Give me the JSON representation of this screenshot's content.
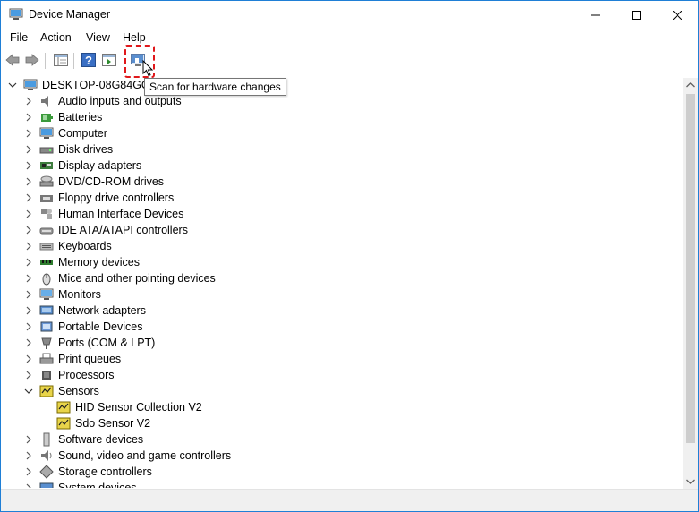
{
  "window": {
    "title": "Device Manager"
  },
  "menu": [
    "File",
    "Action",
    "View",
    "Help"
  ],
  "tooltip": "Scan for hardware changes",
  "colors": {
    "accent": "#1f7fd6",
    "highlight": "#e0181b"
  },
  "tree": {
    "root": "DESKTOP-08G84GC",
    "items": [
      {
        "label": "Audio inputs and outputs",
        "icon": "speaker-icon"
      },
      {
        "label": "Batteries",
        "icon": "battery-icon"
      },
      {
        "label": "Computer",
        "icon": "computer-icon"
      },
      {
        "label": "Disk drives",
        "icon": "disk-drive-icon"
      },
      {
        "label": "Display adapters",
        "icon": "display-adapter-icon"
      },
      {
        "label": "DVD/CD-ROM drives",
        "icon": "dvd-drive-icon"
      },
      {
        "label": "Floppy drive controllers",
        "icon": "floppy-controller-icon"
      },
      {
        "label": "Human Interface Devices",
        "icon": "hid-icon"
      },
      {
        "label": "IDE ATA/ATAPI controllers",
        "icon": "ide-controller-icon"
      },
      {
        "label": "Keyboards",
        "icon": "keyboard-icon"
      },
      {
        "label": "Memory devices",
        "icon": "memory-icon"
      },
      {
        "label": "Mice and other pointing devices",
        "icon": "mouse-icon"
      },
      {
        "label": "Monitors",
        "icon": "monitor-icon"
      },
      {
        "label": "Network adapters",
        "icon": "network-adapter-icon"
      },
      {
        "label": "Portable Devices",
        "icon": "portable-device-icon"
      },
      {
        "label": "Ports (COM & LPT)",
        "icon": "port-icon"
      },
      {
        "label": "Print queues",
        "icon": "printer-icon"
      },
      {
        "label": "Processors",
        "icon": "processor-icon"
      },
      {
        "label": "Sensors",
        "icon": "sensor-icon",
        "expanded": true,
        "children": [
          {
            "label": "HID Sensor Collection V2",
            "icon": "sensor-device-icon"
          },
          {
            "label": "Sdo Sensor V2",
            "icon": "sensor-device-icon"
          }
        ]
      },
      {
        "label": "Software devices",
        "icon": "software-device-icon"
      },
      {
        "label": "Sound, video and game controllers",
        "icon": "sound-controller-icon"
      },
      {
        "label": "Storage controllers",
        "icon": "storage-controller-icon"
      },
      {
        "label": "System devices",
        "icon": "system-device-icon"
      }
    ]
  }
}
